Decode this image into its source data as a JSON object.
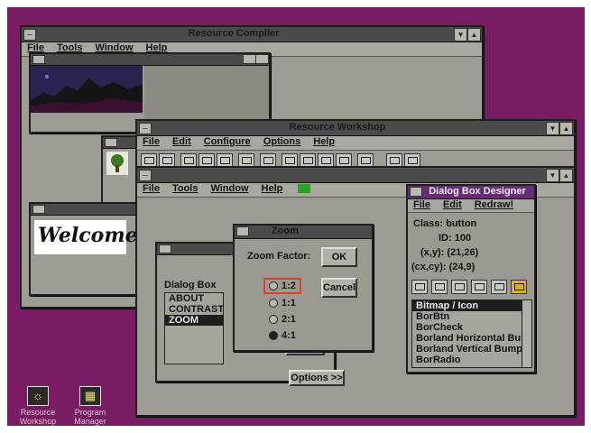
{
  "back_window": {
    "title": "Resource Compiler",
    "menu": [
      "File",
      "Tools",
      "Window",
      "Help"
    ]
  },
  "mid_window": {
    "title": "Resource Workshop",
    "menu": [
      "File",
      "Edit",
      "Configure",
      "Options",
      "Help"
    ]
  },
  "front_window": {
    "menu": [
      "File",
      "Tools",
      "Window",
      "Help"
    ]
  },
  "welcome_bitmap": {
    "text": "Welcome"
  },
  "dialog_box_list": {
    "label": "Dialog Box",
    "items": [
      "ABOUT",
      "CONTRAST",
      "ZOOM"
    ],
    "selected": "ZOOM",
    "options_button": "Options >>"
  },
  "zoom_dialog": {
    "title": "Zoom",
    "zoom_label": "Zoom Factor:",
    "ok": "OK",
    "cancel": "Cancel",
    "options": [
      "1:2",
      "1:1",
      "2:1",
      "4:1"
    ],
    "selected_option": "4:1"
  },
  "designer": {
    "title": "Dialog Box Designer",
    "menu": [
      "File",
      "Edit",
      "Redraw!"
    ],
    "class_label": "Class: button",
    "id_label": "ID: 100",
    "xy_label": "(x,y): (21,26)",
    "cxcy_label": "(cx,cy): (24,9)",
    "controls": [
      "Bitmap / Icon",
      "BorBtn",
      "BorCheck",
      "Borland Horizontal Bum",
      "Borland Vertical Bump",
      "BorRadio"
    ],
    "selected_control": "Bitmap / Icon"
  },
  "desktop_icons": [
    {
      "label": "Resource Workshop",
      "icon": "workshop-icon"
    },
    {
      "label": "Program Manager",
      "icon": "program-manager-icon"
    }
  ],
  "colors": {
    "desktop": "#7a1c63",
    "window": "#9c9c94",
    "selection": "#1e1e1e"
  }
}
